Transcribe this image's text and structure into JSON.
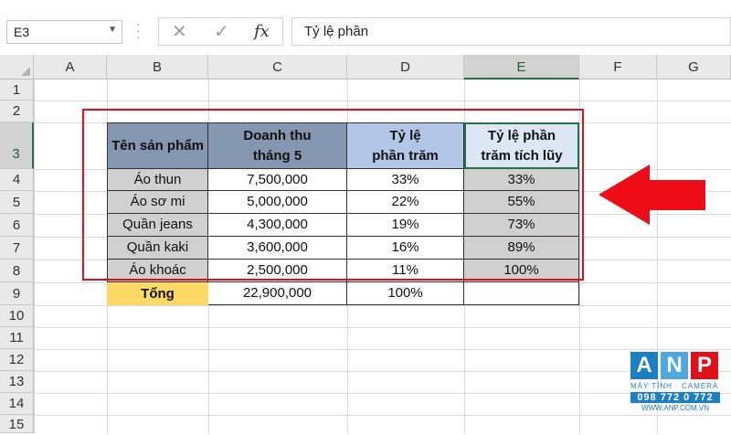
{
  "namebox": {
    "value": "E3"
  },
  "formula_bar": {
    "content": "Tỷ lệ phần",
    "fx_label": "fx",
    "cancel_icon": "x-icon",
    "confirm_icon": "check-icon"
  },
  "columns": [
    "A",
    "B",
    "C",
    "D",
    "E",
    "F",
    "G"
  ],
  "rows": [
    "1",
    "2",
    "3",
    "4",
    "5",
    "6",
    "7",
    "8",
    "9",
    "10",
    "11",
    "12",
    "13",
    "14",
    "15"
  ],
  "table": {
    "headers": {
      "product": "Tên sản phẩm",
      "revenue_l1": "Doanh thu",
      "revenue_l2": "tháng 5",
      "percent_l1": "Tỷ lệ",
      "percent_l2": "phần trăm",
      "cum_l1": "Tỷ lệ phần",
      "cum_l2": "trăm tích lũy"
    },
    "rows": [
      {
        "product": "Áo thun",
        "revenue": "7,500,000",
        "percent": "33%",
        "cum": "33%"
      },
      {
        "product": "Áo sơ mi",
        "revenue": "5,000,000",
        "percent": "22%",
        "cum": "55%"
      },
      {
        "product": "Quần jeans",
        "revenue": "4,300,000",
        "percent": "19%",
        "cum": "73%"
      },
      {
        "product": "Quần kaki",
        "revenue": "3,600,000",
        "percent": "16%",
        "cum": "89%"
      },
      {
        "product": "Áo khoác",
        "revenue": "2,500,000",
        "percent": "11%",
        "cum": "100%"
      }
    ],
    "total": {
      "label": "Tổng",
      "revenue": "22,900,000",
      "percent": "100%"
    }
  },
  "logo": {
    "letters": [
      "A",
      "N",
      "P"
    ],
    "tagline": "MÁY TÍNH · CAMERA",
    "phone": "098 772 0 772",
    "website": "WWW.ANP.COM.VN"
  },
  "colors": {
    "accent_green": "#217346",
    "highlight_red": "#e0101a",
    "header_blue": "#8496b0",
    "total_yellow": "#ffd966"
  }
}
